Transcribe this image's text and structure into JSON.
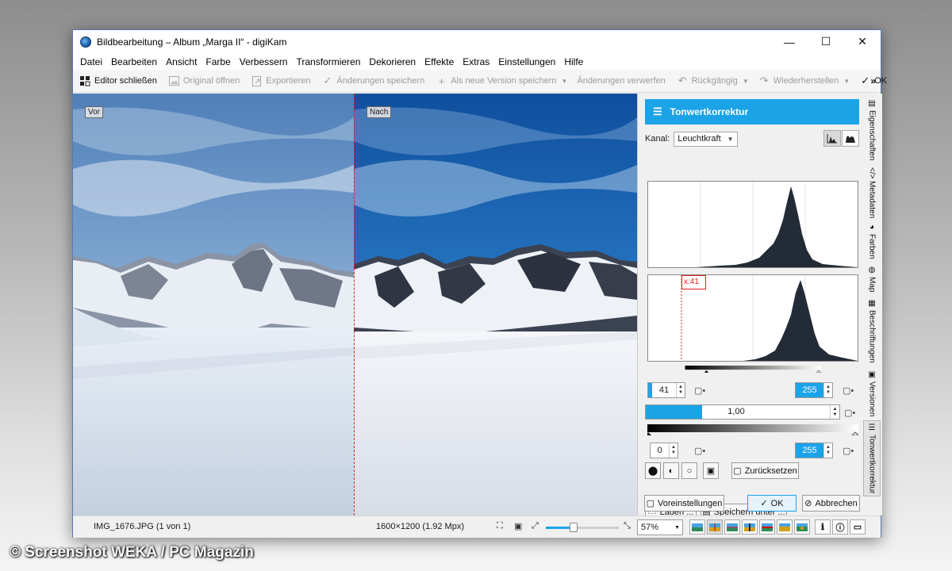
{
  "window": {
    "title": "Bildbearbeitung – Album „Marga II“ - digiKam"
  },
  "window_controls": {
    "minimize": "—",
    "maximize": "☐",
    "close": "✕"
  },
  "menu": [
    "Datei",
    "Bearbeiten",
    "Ansicht",
    "Farbe",
    "Verbessern",
    "Transformieren",
    "Dekorieren",
    "Effekte",
    "Extras",
    "Einstellungen",
    "Hilfe"
  ],
  "toolbar": {
    "close_editor": "Editor schließen",
    "open_original": "Original öffnen",
    "export": "Exportieren",
    "save_changes": "Änderungen speichern",
    "save_new_version": "Als neue Version speichern",
    "discard_changes": "Änderungen verwerfen",
    "undo": "Rückgängig",
    "redo": "Wiederherstellen",
    "ok": "OK",
    "more": "»"
  },
  "canvas": {
    "before_label": "Vor",
    "after_label": "Nach"
  },
  "panel": {
    "title": "Tonwertkorrektur",
    "channel_label": "Kanal:",
    "channel_value": "Leuchtkraft",
    "histogram_marker": "x:41",
    "input_black": "41",
    "input_white": "255",
    "gamma": "1,00",
    "gamma_fraction": 0.29,
    "output_black": "0",
    "output_white": "255",
    "reset": "Zurücksetzen",
    "load": "Laden ...",
    "save_as": "Speichern unter ...",
    "presets": "Voreinstellungen",
    "ok": "OK",
    "cancel": "Abbrechen"
  },
  "side_tabs": [
    "Eigenschaften",
    "Metadaten",
    "Farben",
    "Map",
    "Beschriftungen",
    "Versionen",
    "Tonwertkorrektur"
  ],
  "status": {
    "file": "IMG_1676.JPG (1 von 1)",
    "size": "1600×1200 (1.92 Mpx)",
    "zoom_percent": "57%",
    "zoom_fraction": 0.38
  },
  "watermark": "© Screenshot WEKA / PC Magazin",
  "colors": {
    "accent": "#1ba3e8",
    "split_line": "#e0201a"
  }
}
